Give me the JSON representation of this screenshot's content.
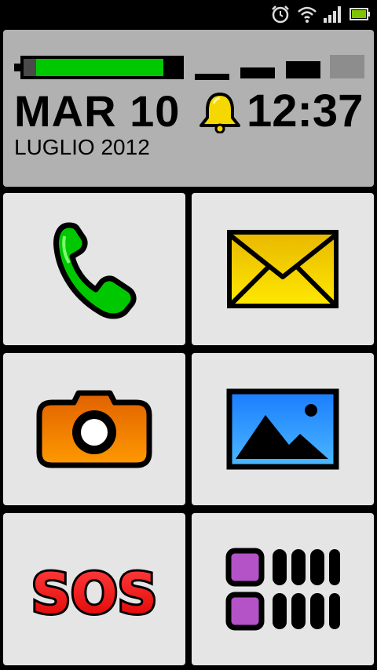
{
  "status_bar": {
    "icons": [
      "alarm-clock-icon",
      "wifi-icon",
      "cell-signal-icon",
      "battery-icon"
    ],
    "battery_color": "#00c800"
  },
  "header": {
    "battery_level_fraction": 0.88,
    "date_main": "MAR 10",
    "date_sub": "LUGLIO 2012",
    "time": "12:37",
    "alarm_icon": "bell-icon"
  },
  "tiles": [
    {
      "name": "phone",
      "icon": "phone-icon",
      "color": "#00c800"
    },
    {
      "name": "messages",
      "icon": "envelope-icon",
      "color": "#f5d800"
    },
    {
      "name": "camera",
      "icon": "camera-icon",
      "color": "#f07000"
    },
    {
      "name": "gallery",
      "icon": "picture-icon",
      "color": "#2a9bff"
    },
    {
      "name": "sos",
      "icon": "sos-icon",
      "label": "SOS",
      "color": "#e31b1b"
    },
    {
      "name": "apps",
      "icon": "app-grid-icon",
      "color": "#b452c8"
    }
  ]
}
